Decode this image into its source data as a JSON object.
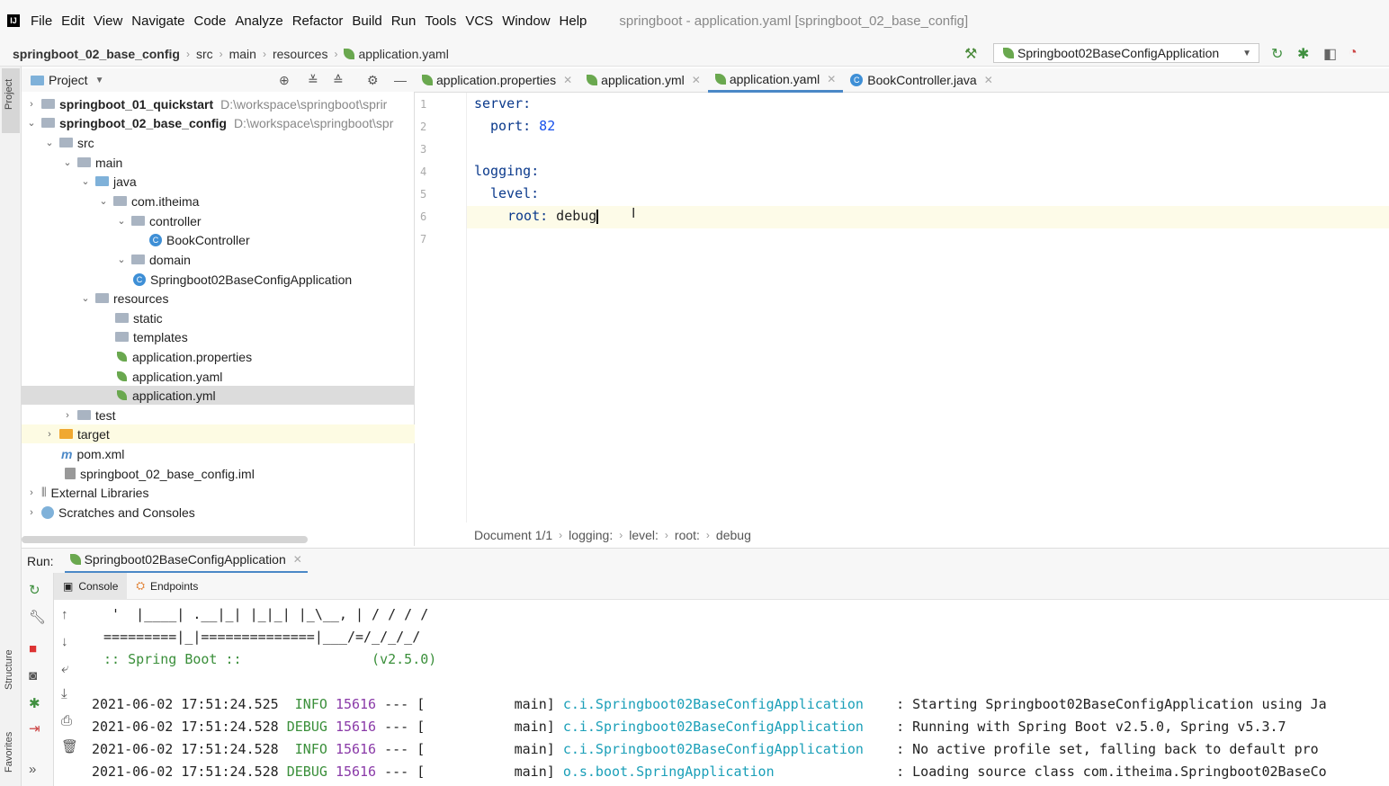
{
  "menu": [
    "File",
    "Edit",
    "View",
    "Navigate",
    "Code",
    "Analyze",
    "Refactor",
    "Build",
    "Run",
    "Tools",
    "VCS",
    "Window",
    "Help"
  ],
  "window_title": "springboot - application.yaml [springboot_02_base_config]",
  "breadcrumb": [
    "springboot_02_base_config",
    "src",
    "main",
    "resources",
    "application.yaml"
  ],
  "run_config": "Springboot02BaseConfigApplication",
  "project_panel": {
    "title": "Project",
    "tree": [
      {
        "label": "springboot_01_quickstart",
        "path": "D:\\workspace\\springboot\\sprir"
      },
      {
        "label": "springboot_02_base_config",
        "path": "D:\\workspace\\springboot\\spr"
      },
      {
        "label": "src"
      },
      {
        "label": "main"
      },
      {
        "label": "java"
      },
      {
        "label": "com.itheima"
      },
      {
        "label": "controller"
      },
      {
        "label": "BookController"
      },
      {
        "label": "domain"
      },
      {
        "label": "Springboot02BaseConfigApplication"
      },
      {
        "label": "resources"
      },
      {
        "label": "static"
      },
      {
        "label": "templates"
      },
      {
        "label": "application.properties"
      },
      {
        "label": "application.yaml"
      },
      {
        "label": "application.yml"
      },
      {
        "label": "test"
      },
      {
        "label": "target"
      },
      {
        "label": "pom.xml"
      },
      {
        "label": "springboot_02_base_config.iml"
      },
      {
        "label": "External Libraries"
      },
      {
        "label": "Scratches and Consoles"
      }
    ]
  },
  "editor_tabs": [
    "application.properties",
    "application.yml",
    "application.yaml",
    "BookController.java"
  ],
  "code": {
    "line_numbers": [
      "1",
      "2",
      "3",
      "4",
      "5",
      "6",
      "7"
    ],
    "lines": [
      {
        "k": "server:",
        "v": ""
      },
      {
        "k": "port:",
        "v": " 82"
      },
      {
        "k": "",
        "v": ""
      },
      {
        "k": "logging:",
        "v": ""
      },
      {
        "k": "level:",
        "v": ""
      },
      {
        "k": "root:",
        "v": " debug"
      },
      {
        "k": "",
        "v": ""
      }
    ]
  },
  "editor_breadcrumb": [
    "Document 1/1",
    "logging:",
    "level:",
    "root:",
    "debug"
  ],
  "run": {
    "label": "Run:",
    "tab": "Springboot02BaseConfigApplication",
    "subtabs": [
      "Console",
      "Endpoints"
    ]
  },
  "side_labels": {
    "project": "Project",
    "structure": "Structure",
    "favorites": "Favorites"
  },
  "console": {
    "banner": [
      "  '  |____| .__|_| |_|_| |_\\__, | / / / /",
      " =========|_|==============|___/=/_/_/_/",
      " :: Spring Boot ::                (v2.5.0)"
    ],
    "logs": [
      {
        "ts": "2021-06-02 17:51:24.525",
        "level": " INFO",
        "pid": "15616",
        "sep": "--- [",
        "thread": "           main]",
        "logger": "c.i.Springboot02BaseConfigApplication",
        "msg": "    : Starting Springboot02BaseConfigApplication using Ja"
      },
      {
        "ts": "2021-06-02 17:51:24.528",
        "level": "DEBUG",
        "pid": "15616",
        "sep": "--- [",
        "thread": "           main]",
        "logger": "c.i.Springboot02BaseConfigApplication",
        "msg": "    : Running with Spring Boot v2.5.0, Spring v5.3.7"
      },
      {
        "ts": "2021-06-02 17:51:24.528",
        "level": " INFO",
        "pid": "15616",
        "sep": "--- [",
        "thread": "           main]",
        "logger": "c.i.Springboot02BaseConfigApplication",
        "msg": "    : No active profile set, falling back to default pro"
      },
      {
        "ts": "2021-06-02 17:51:24.528",
        "level": "DEBUG",
        "pid": "15616",
        "sep": "--- [",
        "thread": "           main]",
        "logger": "o.s.boot.SpringApplication",
        "msg": "               : Loading source class com.itheima.Springboot02BaseCo"
      }
    ]
  }
}
